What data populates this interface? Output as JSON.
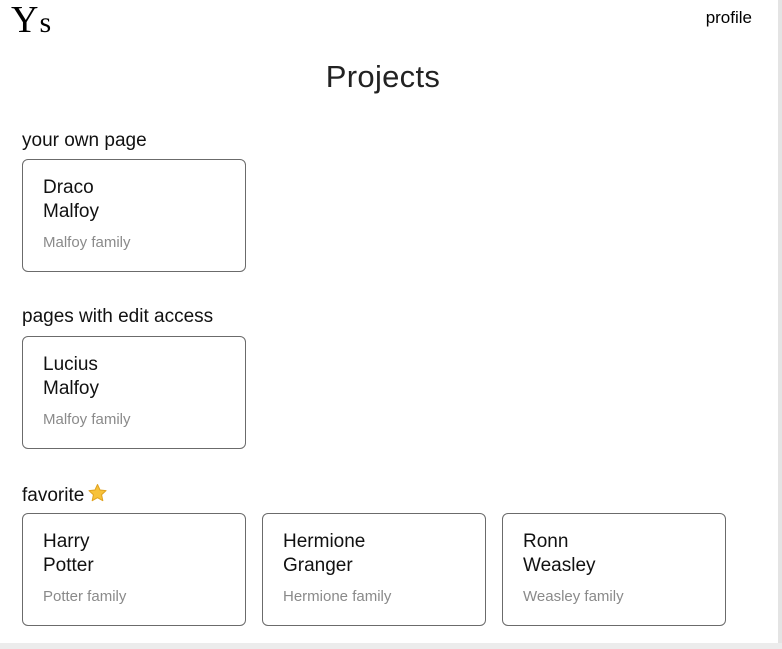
{
  "header": {
    "logo_text_big": "Y",
    "logo_text_small": "s",
    "profile_label": "profile"
  },
  "main": {
    "title": "Projects",
    "sections": [
      {
        "heading": "your own page",
        "cards": [
          {
            "first_name": "Draco",
            "last_name": "Malfoy",
            "family": "Malfoy family"
          }
        ]
      },
      {
        "heading": "pages with edit access",
        "cards": [
          {
            "first_name": "Lucius",
            "last_name": "Malfoy",
            "family": "Malfoy family"
          }
        ]
      },
      {
        "heading": "favorite",
        "heading_icon": "star-icon",
        "cards": [
          {
            "first_name": "Harry",
            "last_name": "Potter",
            "family": "Potter family"
          },
          {
            "first_name": "Hermione",
            "last_name": "Granger",
            "family": "Hermione family"
          },
          {
            "first_name": "Ronn",
            "last_name": "Weasley",
            "family": "Weasley family"
          }
        ]
      }
    ]
  },
  "colors": {
    "star_fill": "#f7c23a",
    "star_stroke": "#e0a21f",
    "card_border": "#6b6b6b",
    "muted_text": "#8a8a8a"
  }
}
